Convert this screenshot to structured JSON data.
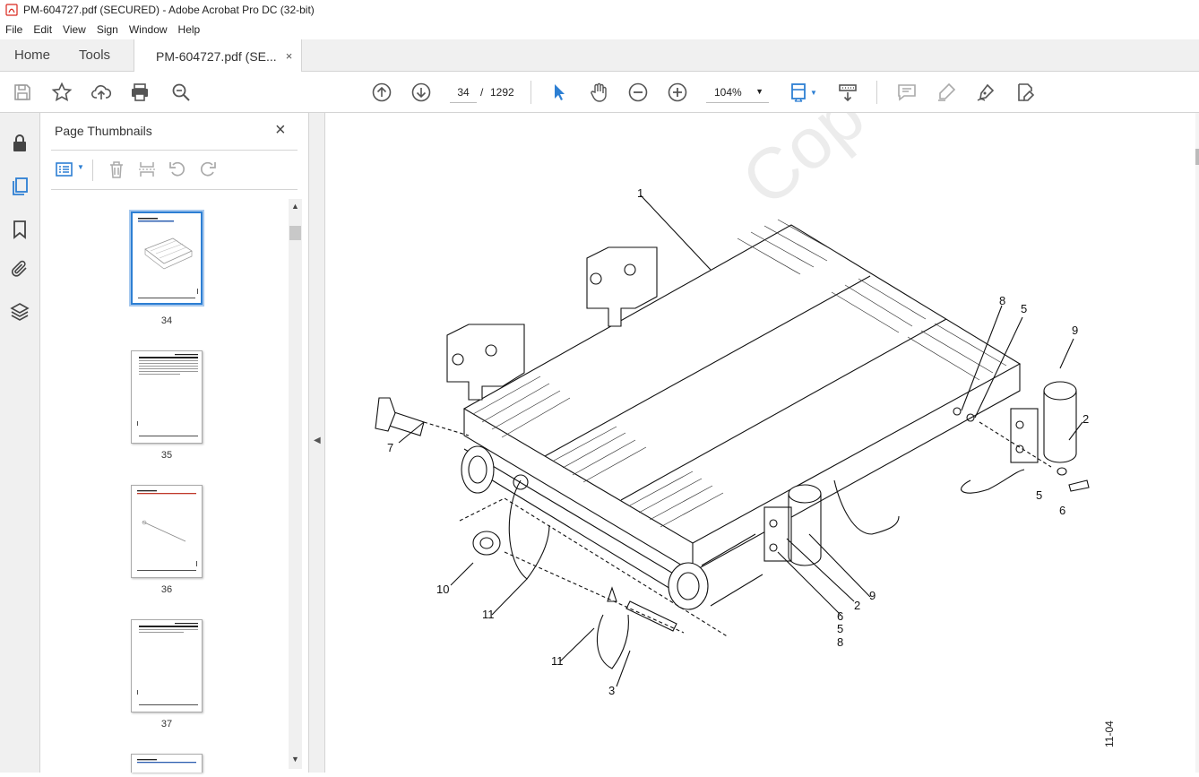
{
  "window": {
    "title": "PM-604727.pdf (SECURED) - Adobe Acrobat Pro DC (32-bit)"
  },
  "menu": [
    "File",
    "Edit",
    "View",
    "Sign",
    "Window",
    "Help"
  ],
  "tabs": {
    "home": "Home",
    "tools": "Tools",
    "document": "PM-604727.pdf (SE...",
    "close": "×"
  },
  "nav": {
    "current_page": "34",
    "separator": "/",
    "total_pages": "1292",
    "zoom": "104%"
  },
  "panel": {
    "title": "Page Thumbnails",
    "close": "×",
    "thumbnails": [
      {
        "page": "34",
        "selected": true
      },
      {
        "page": "35",
        "selected": false
      },
      {
        "page": "36",
        "selected": false
      },
      {
        "page": "37",
        "selected": false
      }
    ]
  },
  "drawing": {
    "callouts": {
      "c1": "1",
      "c8a": "8",
      "c5a": "5",
      "c9a": "9",
      "c2a": "2",
      "c7": "7",
      "c5b": "5",
      "c6a": "6",
      "c10": "10",
      "c11a": "11",
      "c9b": "9",
      "c2b": "2",
      "c6b": "6",
      "c5c": "5",
      "c8b": "8",
      "c11b": "11",
      "c3": "3"
    },
    "doc_number": "11-04"
  },
  "colors": {
    "accent": "#2d7fd3",
    "icon": "#555555",
    "selection": "#2d7fd3"
  }
}
